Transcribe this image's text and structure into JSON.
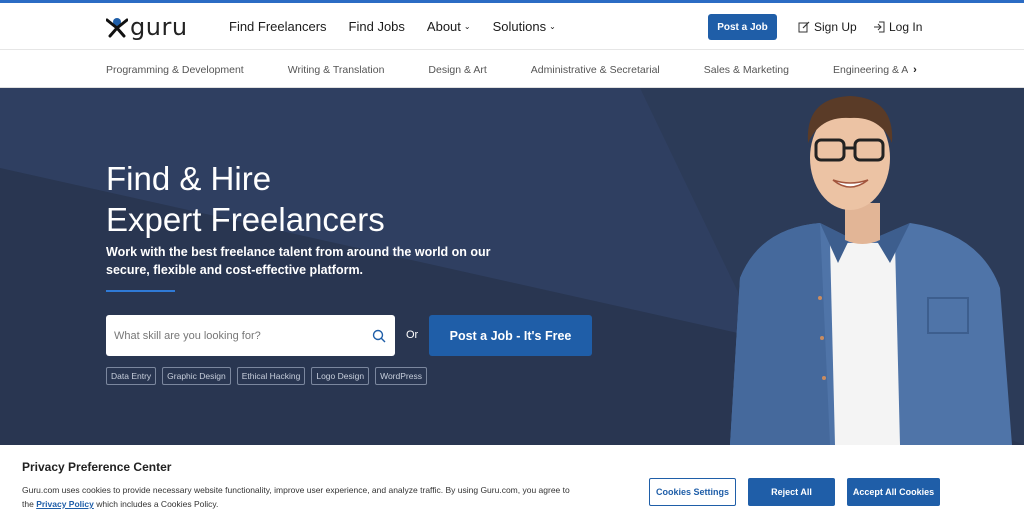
{
  "header": {
    "logo_text": "guru",
    "nav": [
      {
        "label": "Find Freelancers",
        "has_caret": false
      },
      {
        "label": "Find Jobs",
        "has_caret": false
      },
      {
        "label": "About",
        "has_caret": true
      },
      {
        "label": "Solutions",
        "has_caret": true
      }
    ],
    "post_job_label": "Post a Job",
    "signup_label": "Sign Up",
    "login_label": "Log In"
  },
  "categories": [
    "Programming & Development",
    "Writing & Translation",
    "Design & Art",
    "Administrative & Secretarial",
    "Sales & Marketing",
    "Engineering & Architecture"
  ],
  "hero": {
    "title_line1": "Find & Hire",
    "title_line2": "Expert Freelancers",
    "subtitle": "Work with the best freelance talent from around the world on our secure, flexible and cost-effective platform.",
    "search_placeholder": "What skill are you looking for?",
    "or_label": "Or",
    "cta_label": "Post a Job - It's Free",
    "tags": [
      "Data Entry",
      "Graphic Design",
      "Ethical Hacking",
      "Logo Design",
      "WordPress"
    ]
  },
  "privacy": {
    "title": "Privacy Preference Center",
    "text_before_link": "Guru.com uses cookies to provide necessary website functionality, improve user experience, and analyze traffic. By using Guru.com, you agree to the ",
    "link_label": "Privacy Policy",
    "text_after_link": " which includes a Cookies Policy.",
    "settings_label": "Cookies Settings",
    "reject_label": "Reject All",
    "accept_label": "Accept All Cookies"
  },
  "colors": {
    "brand_blue": "#1f5ea8",
    "hero_bg": "#2c3b58",
    "accent_line": "#2f7ad6"
  }
}
